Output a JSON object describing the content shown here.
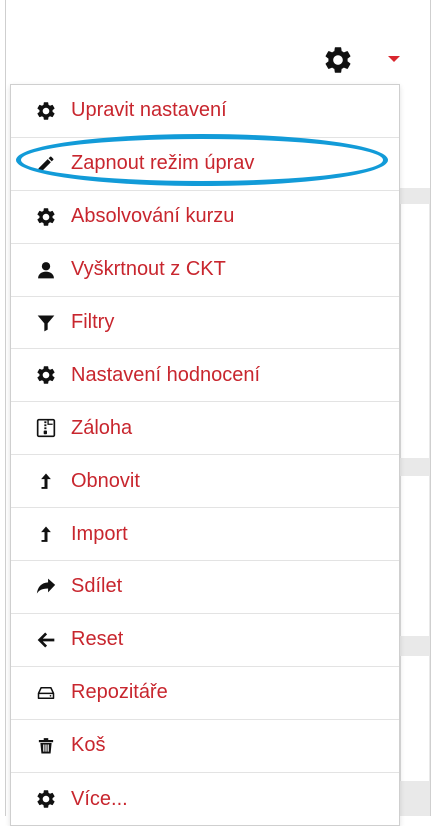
{
  "colors": {
    "accent": "#c8262e",
    "highlight": "#129bd8",
    "icon": "#111111"
  },
  "toolbar": {
    "settings_icon": "gear-icon",
    "dropdown_icon": "caret-down-icon"
  },
  "menu": {
    "items": [
      {
        "label": "Upravit nastavení",
        "icon": "gear-icon"
      },
      {
        "label": "Zapnout režim úprav",
        "icon": "pencil-icon",
        "highlighted": true
      },
      {
        "label": "Absolvování kurzu",
        "icon": "gear-icon"
      },
      {
        "label": "Vyškrtnout z CKT",
        "icon": "user-icon"
      },
      {
        "label": "Filtry",
        "icon": "filter-icon"
      },
      {
        "label": "Nastavení hodnocení",
        "icon": "gear-icon"
      },
      {
        "label": "Záloha",
        "icon": "archive-icon"
      },
      {
        "label": "Obnovit",
        "icon": "upload-icon"
      },
      {
        "label": "Import",
        "icon": "upload-icon"
      },
      {
        "label": "Sdílet",
        "icon": "share-icon"
      },
      {
        "label": "Reset",
        "icon": "arrow-left-icon"
      },
      {
        "label": "Repozitáře",
        "icon": "hdd-icon"
      },
      {
        "label": "Koš",
        "icon": "trash-icon"
      },
      {
        "label": "Více...",
        "icon": "gear-icon"
      }
    ]
  }
}
